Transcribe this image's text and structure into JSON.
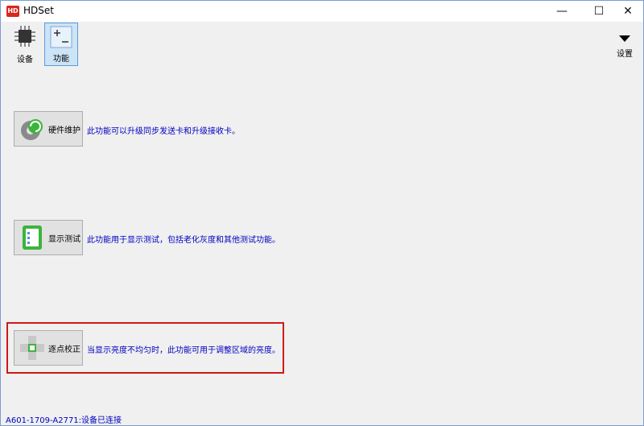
{
  "window": {
    "title": "HDSet",
    "icon_text": "HD"
  },
  "controls": {
    "minimize": "—",
    "maximize": "☐",
    "close": "✕"
  },
  "toolbar": {
    "device_label": "设备",
    "function_label": "功能"
  },
  "settings": {
    "label": "设置",
    "icon": "triangle-down-icon"
  },
  "features": [
    {
      "label": "硬件维护",
      "description": "此功能可以升级同步发送卡和升级接收卡。",
      "icon": "gear-refresh-icon"
    },
    {
      "label": "显示测试",
      "description": "此功能用于显示测试，包括老化灰度和其他测试功能。",
      "icon": "display-test-icon"
    },
    {
      "label": "逐点校正",
      "description": "当显示亮度不均匀时，此功能可用于调整区域的亮度。",
      "icon": "point-correction-icon"
    }
  ],
  "status": {
    "text": "A601-1709-A2771:设备已连接"
  },
  "colors": {
    "accent": "#0000c0",
    "highlight": "#d01818",
    "selected_bg": "#cde4f7"
  }
}
